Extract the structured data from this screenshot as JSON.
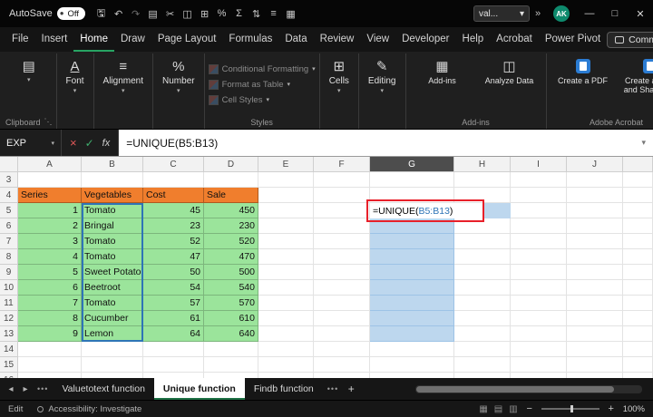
{
  "titlebar": {
    "autosave_label": "AutoSave",
    "autosave_state": "Off",
    "search_value": "val...",
    "avatar": "AK"
  },
  "icons": {
    "autosave_dot": "●",
    "undo": "↶",
    "redo": "↷",
    "qat": [
      "▤",
      "✂",
      "◫",
      "⊞",
      "%",
      "Σ",
      "⇅",
      "≡",
      "▦"
    ],
    "more": "»",
    "chevron_down": "▾",
    "cancel": "×",
    "enter": "✓",
    "fx": "fx",
    "nav_left": "◂",
    "nav_right": "▸",
    "minimize": "—",
    "maximize": "□",
    "close": "✕",
    "share": "↗",
    "paste": "▤",
    "font": "A",
    "alignment": "≡",
    "number": "%",
    "cells": "⊞",
    "editing": "✎",
    "addins": "▦",
    "analyze": "◫",
    "tabs_overflow": "•••",
    "add_tab": "+",
    "dialog_launcher": "⋱"
  },
  "menubar": {
    "tabs": [
      "File",
      "Insert",
      "Home",
      "Draw",
      "Page Layout",
      "Formulas",
      "Data",
      "Review",
      "View",
      "Developer",
      "Help",
      "Acrobat",
      "Power Pivot"
    ],
    "active_tab": "Home",
    "comments_label": "Comments"
  },
  "ribbon": {
    "group_clipboard": "Clipboard",
    "font_label": "Font",
    "alignment_label": "Alignment",
    "number_label": "Number",
    "styles_items": [
      "Conditional Formatting",
      "Format as Table",
      "Cell Styles"
    ],
    "group_styles": "Styles",
    "cells_label": "Cells",
    "editing_label": "Editing",
    "addins_label": "Add-ins",
    "analyze_label": "Analyze Data",
    "group_addins": "Add-ins",
    "pdf_label": "Create a PDF",
    "pdf_share_label": "Create a PDF and Share link",
    "group_acrobat": "Adobe Acrobat"
  },
  "formula_bar": {
    "name_box": "EXP",
    "formula": "=UNIQUE(B5:B13)"
  },
  "grid": {
    "columns": [
      "A",
      "B",
      "C",
      "D",
      "E",
      "F",
      "G",
      "H",
      "I",
      "J"
    ],
    "row_start": 3,
    "row_end": 16,
    "selected_column": "G",
    "table": {
      "headers": [
        "Series",
        "Vegetables",
        "Cost",
        "Sale"
      ],
      "rows": [
        [
          "1",
          "Tomato",
          "45",
          "450"
        ],
        [
          "2",
          "Bringal",
          "23",
          "230"
        ],
        [
          "3",
          "Tomato",
          "52",
          "520"
        ],
        [
          "4",
          "Tomato",
          "47",
          "470"
        ],
        [
          "5",
          "Sweet Potato",
          "50",
          "500"
        ],
        [
          "6",
          "Beetroot",
          "54",
          "540"
        ],
        [
          "7",
          "Tomato",
          "57",
          "570"
        ],
        [
          "8",
          "Cucumber",
          "61",
          "610"
        ],
        [
          "9",
          "Lemon",
          "64",
          "640"
        ]
      ]
    },
    "active_cell": {
      "ref": "G5",
      "formula_prefix": "=UNIQUE(",
      "formula_range": "B5:B13",
      "formula_suffix": ")"
    },
    "colors": {
      "table_header_fill": "#F07E2D",
      "table_data_fill": "#9BE49B",
      "spill_fill": "#BDD7EE",
      "annotation_border": "#E8202A",
      "reference_border": "#2E75B6"
    }
  },
  "sheet_tabs": {
    "tabs": [
      "Valuetotext function",
      "Unique function",
      "Findb function"
    ],
    "active": "Unique function"
  },
  "status_bar": {
    "mode": "Edit",
    "accessibility": "Accessibility: Investigate",
    "zoom": "100%"
  }
}
